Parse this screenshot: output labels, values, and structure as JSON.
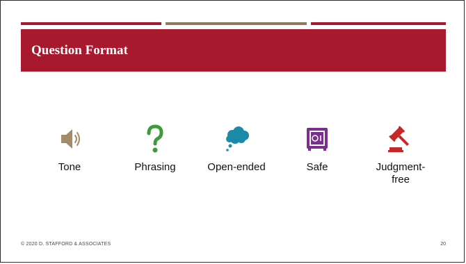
{
  "slide": {
    "title": "Question Format",
    "page_number": "20",
    "footer": "© 2020 D. STAFFORD & ASSOCIATES"
  },
  "colors": {
    "brand_red": "#A8192E",
    "accent_olive": "#8B7D5B",
    "speaker_tan": "#A38B68",
    "question_green": "#3C9B3C",
    "cloud_teal": "#1A8AA8",
    "safe_purple": "#7A2E8E",
    "gavel_red": "#C62828"
  },
  "items": [
    {
      "label": "Tone",
      "icon": "speaker-icon"
    },
    {
      "label": "Phrasing",
      "icon": "question-mark-icon"
    },
    {
      "label": "Open-ended",
      "icon": "thought-cloud-icon"
    },
    {
      "label": "Safe",
      "icon": "safe-icon"
    },
    {
      "label": "Judgment-\nfree",
      "icon": "gavel-icon"
    }
  ]
}
